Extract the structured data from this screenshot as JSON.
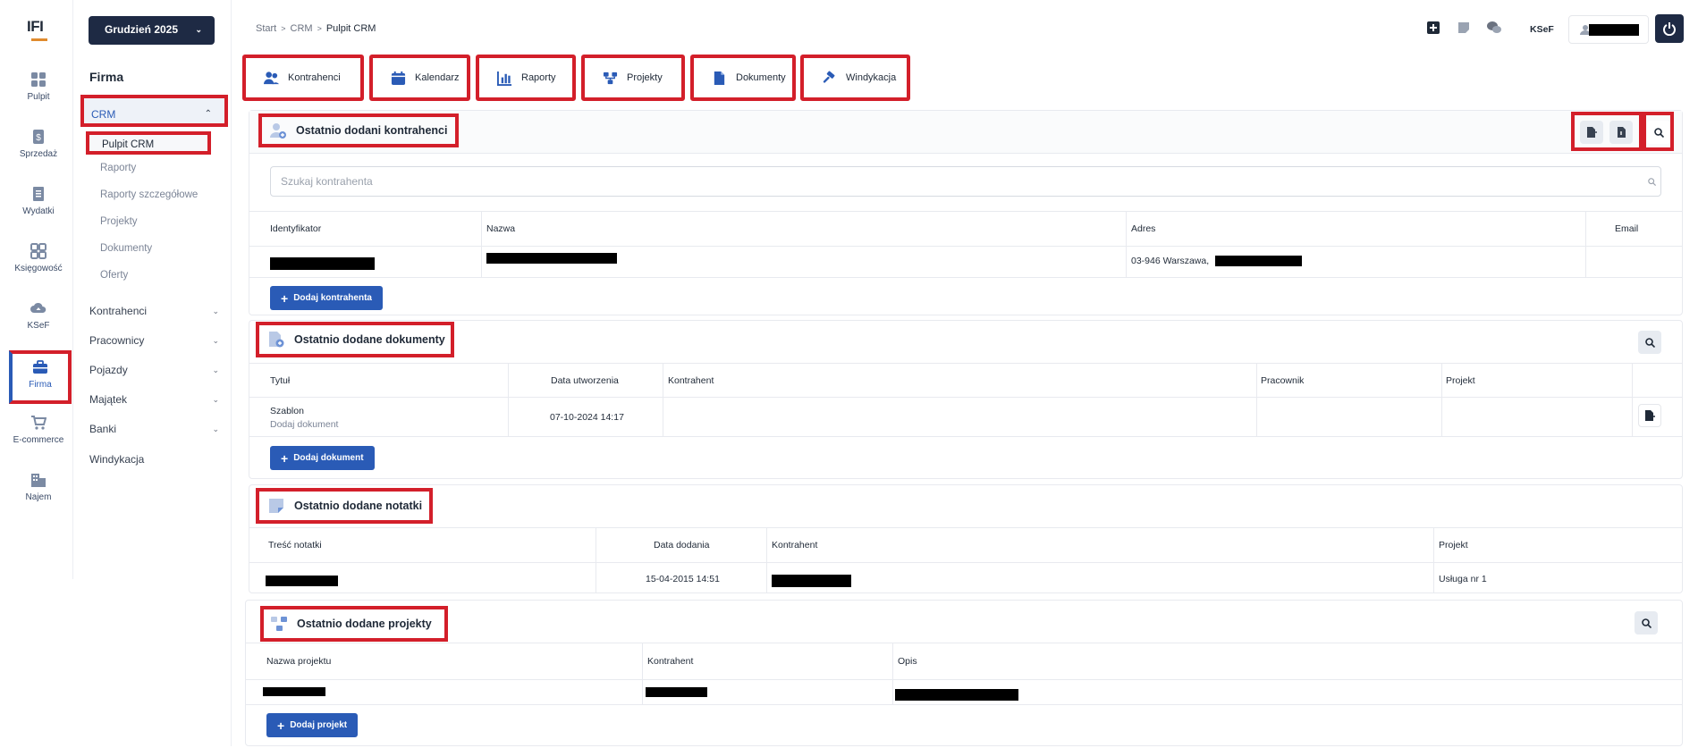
{
  "brand": {
    "logo_text": "IFI"
  },
  "rail": [
    {
      "label": "Pulpit",
      "icon": "grid-icon"
    },
    {
      "label": "Sprzedaż",
      "icon": "dollar-doc-icon"
    },
    {
      "label": "Wydatki",
      "icon": "receipt-icon"
    },
    {
      "label": "Księgowość",
      "icon": "calc-grid-icon"
    },
    {
      "label": "KSeF",
      "icon": "cloud-upload-icon"
    },
    {
      "label": "Firma",
      "icon": "briefcase-icon"
    },
    {
      "label": "E-commerce",
      "icon": "cart-icon"
    },
    {
      "label": "Najem",
      "icon": "building-icon"
    }
  ],
  "submenu": {
    "month": "Grudzień 2025",
    "title": "Firma",
    "crm": "CRM",
    "crm_items": [
      "Pulpit CRM",
      "Raporty",
      "Raporty szczegółowe",
      "Projekty",
      "Dokumenty",
      "Oferty"
    ],
    "groups": [
      "Kontrahenci",
      "Pracownicy",
      "Pojazdy",
      "Majątek",
      "Banki",
      "Windykacja"
    ]
  },
  "breadcrumb": {
    "items": [
      "Start",
      "CRM"
    ],
    "current": "Pulpit CRM"
  },
  "topbar": {
    "ksef": "KSeF"
  },
  "tabs": [
    "Kontrahenci",
    "Kalendarz",
    "Raporty",
    "Projekty",
    "Dokumenty",
    "Windykacja"
  ],
  "contractors": {
    "title": "Ostatnio dodani kontrahenci",
    "search_placeholder": "Szukaj kontrahenta",
    "columns": [
      "Identyfikator",
      "Nazwa",
      "Adres",
      "Email"
    ],
    "row_address": "03-946 Warszawa, ",
    "add_label": "Dodaj kontrahenta"
  },
  "documents": {
    "title": "Ostatnio dodane dokumenty",
    "columns": [
      "Tytuł",
      "Data utworzenia",
      "Kontrahent",
      "Pracownik",
      "Projekt"
    ],
    "row": {
      "title": "Szablon",
      "subtitle": "Dodaj dokument",
      "date": "07-10-2024 14:17"
    },
    "add_label": "Dodaj dokument"
  },
  "notes": {
    "title": "Ostatnio dodane notatki",
    "columns": [
      "Treść notatki",
      "Data dodania",
      "Kontrahent",
      "Projekt"
    ],
    "row": {
      "date": "15-04-2015 14:51",
      "project": "Usługa nr 1"
    }
  },
  "projects": {
    "title": "Ostatnio dodane projekty",
    "columns": [
      "Nazwa projektu",
      "Kontrahent",
      "Opis"
    ],
    "add_label": "Dodaj projekt"
  },
  "colors": {
    "accent": "#2a5bb6",
    "navy": "#1e2a44",
    "highlight": "#d31f2a"
  }
}
